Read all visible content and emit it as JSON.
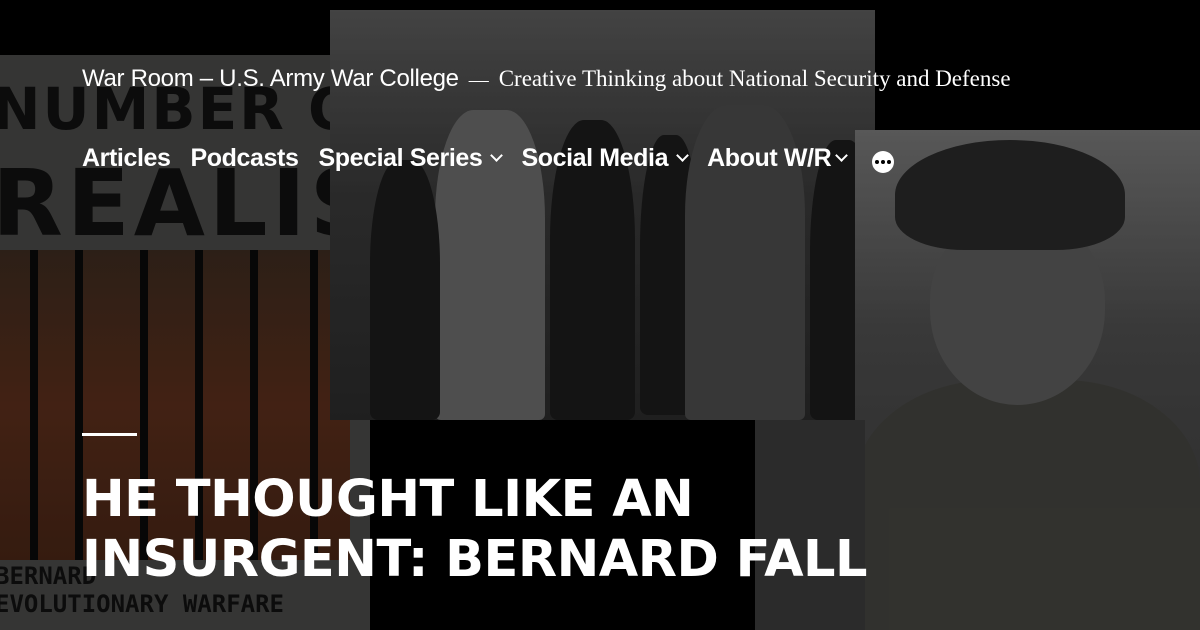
{
  "site": {
    "title": "War Room – U.S. Army War College",
    "separator": "—",
    "tagline": "Creative Thinking about National Security and Defense"
  },
  "nav": {
    "items": [
      {
        "label": "Articles",
        "has_submenu": false
      },
      {
        "label": "Podcasts",
        "has_submenu": false
      },
      {
        "label": "Special Series",
        "has_submenu": true
      },
      {
        "label": "Social Media",
        "has_submenu": true
      },
      {
        "label": "About W/R",
        "has_submenu": true
      }
    ],
    "more_icon": "ellipsis-icon"
  },
  "article": {
    "headline": "HE THOUGHT LIKE AN INSURGENT: BERNARD FALL"
  },
  "background_art": {
    "cover_text_line1": "NUMBER ONE",
    "cover_text_line2": "REALIST",
    "cover_text_line3": "BERNARD",
    "cover_text_line4": "EVOLUTIONARY WARFARE"
  },
  "colors": {
    "text": "#ffffff",
    "background": "#000000"
  }
}
